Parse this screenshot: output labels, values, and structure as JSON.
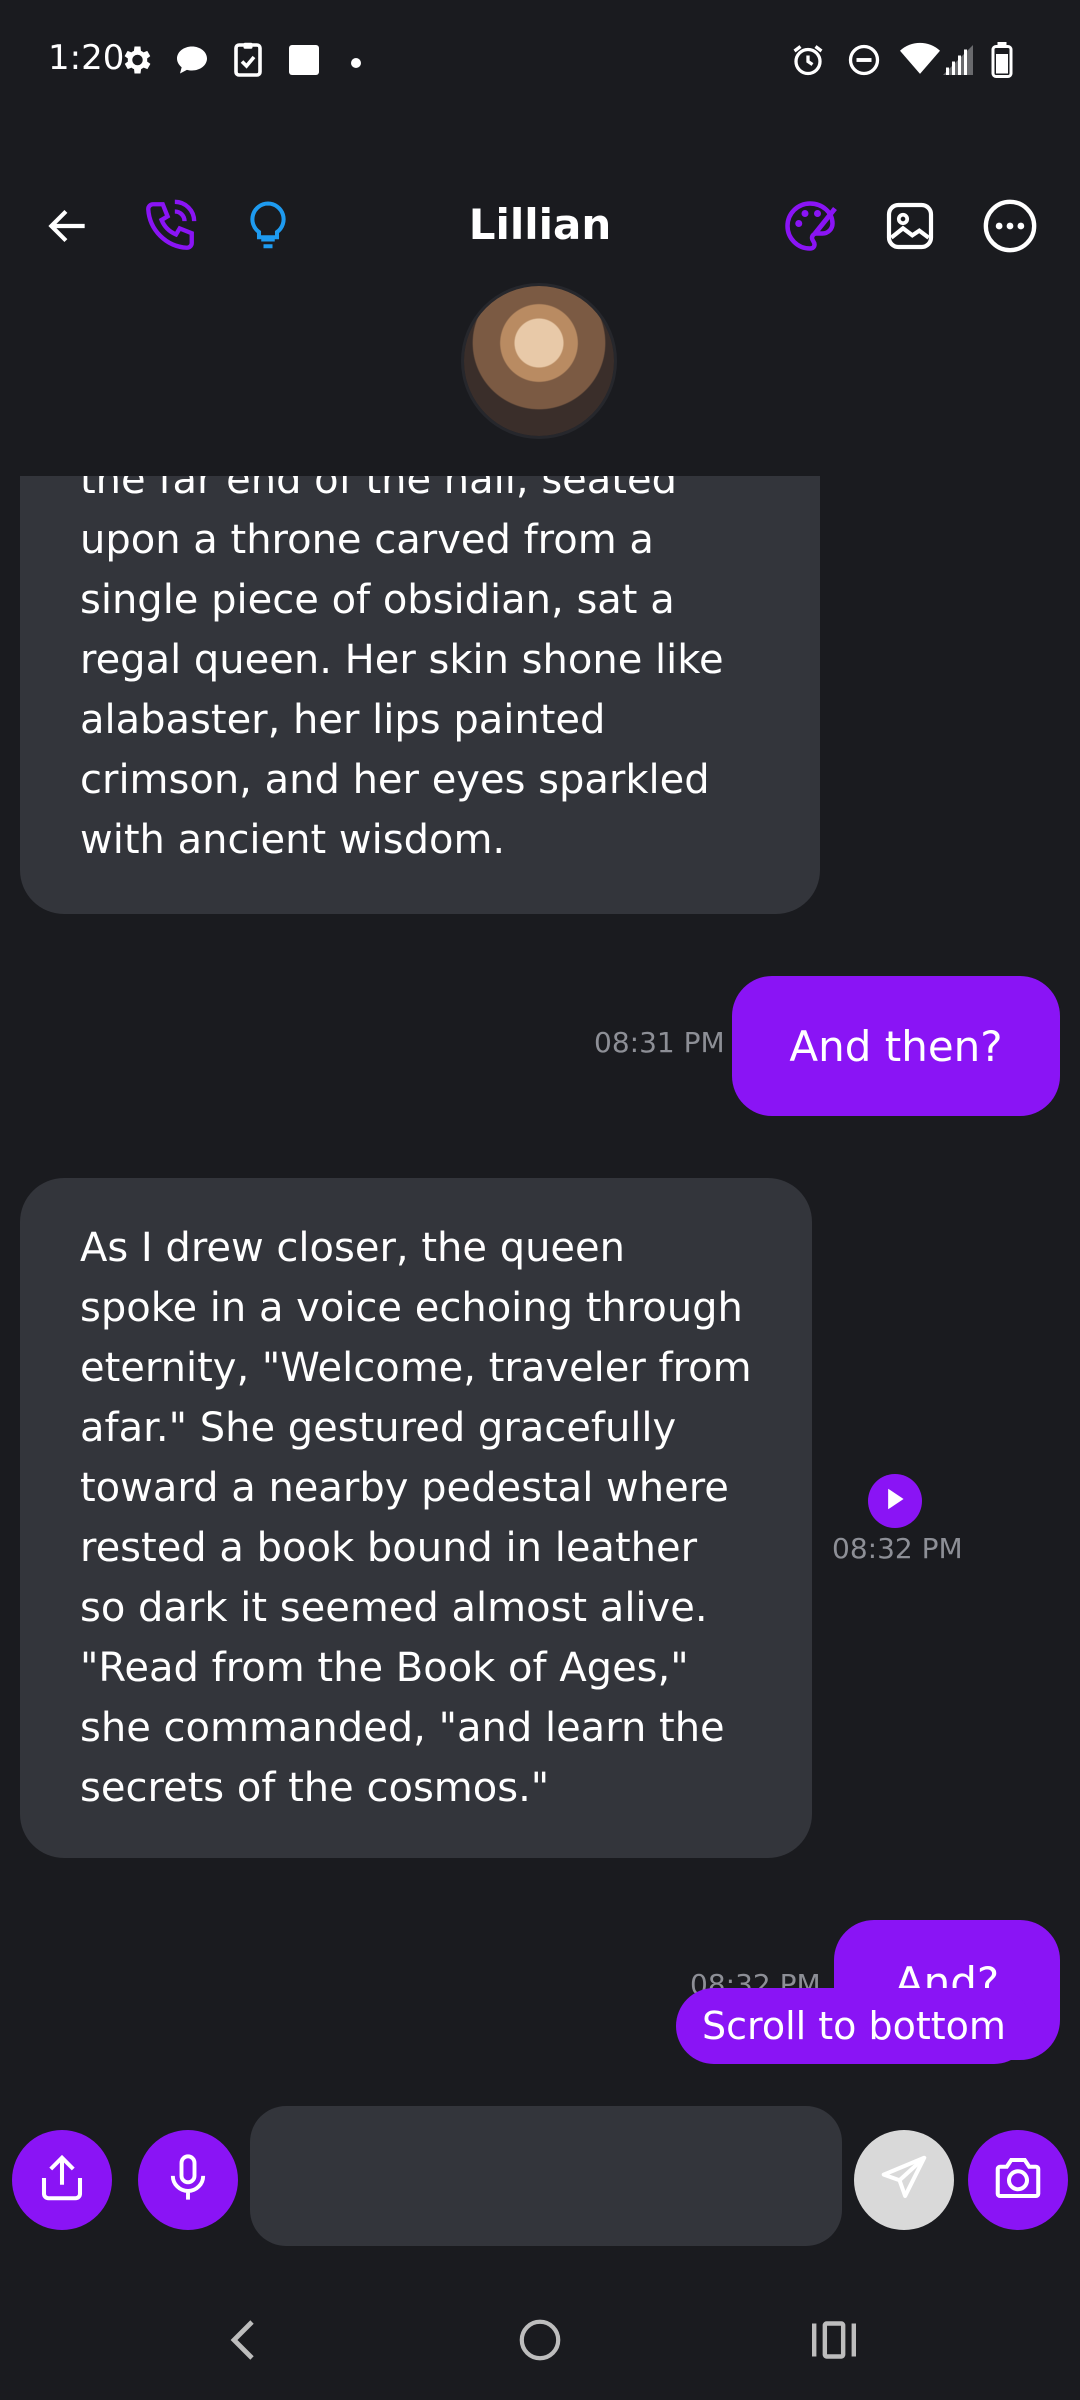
{
  "status_bar": {
    "time": "1:20",
    "left_icons": [
      "gear-icon",
      "chat-bubble-icon",
      "clipboard-check-icon",
      "square-icon",
      "dot-icon"
    ],
    "right_icons": [
      "alarm-icon",
      "do-not-disturb-icon",
      "wifi-icon",
      "signal-icon",
      "battery-icon"
    ]
  },
  "header": {
    "title": "Lillian",
    "left_icons": [
      "back-arrow-icon",
      "phone-icon",
      "lightbulb-icon"
    ],
    "right_icons": [
      "palette-icon",
      "image-icon",
      "more-options-icon"
    ],
    "accent_colors": {
      "purple": "#8a14f5",
      "blue": "#1e9bf0"
    }
  },
  "messages": [
    {
      "role": "ai",
      "text": "the far end of the hall, seated\nupon a throne carved from a\nsingle piece of obsidian, sat a\nregal queen. Her skin shone like\nalabaster, her lips painted\ncrimson, and her eyes sparkled\nwith ancient wisdom."
    },
    {
      "role": "user",
      "text": "And then?",
      "time": "08:31 PM"
    },
    {
      "role": "ai",
      "text": "As I drew closer, the queen\nspoke in a voice echoing through\neternity, \"Welcome, traveler from\nafar.\" She gestured gracefully\ntoward a nearby pedestal where\nrested a book bound in leather\nso dark it seemed almost alive.\n\"Read from the Book of Ages,\"\nshe commanded, \"and learn the\nsecrets of the cosmos.\"",
      "time": "08:32 PM"
    },
    {
      "role": "user",
      "text": "And?",
      "time": "08:32 PM"
    }
  ],
  "scroll_to_bottom_label": "Scroll to bottom",
  "input_bar": {
    "placeholder": "",
    "value": "",
    "buttons": [
      "share-icon",
      "microphone-icon",
      "send-icon",
      "camera-icon"
    ]
  },
  "nav_bar": {
    "buttons": [
      "back-nav-icon",
      "home-nav-icon",
      "recents-nav-icon"
    ]
  },
  "colors": {
    "background": "#1a1b1f",
    "ai_bubble": "#33353b",
    "user_bubble": "#8a14f5",
    "timestamp": "#8d8f96"
  }
}
